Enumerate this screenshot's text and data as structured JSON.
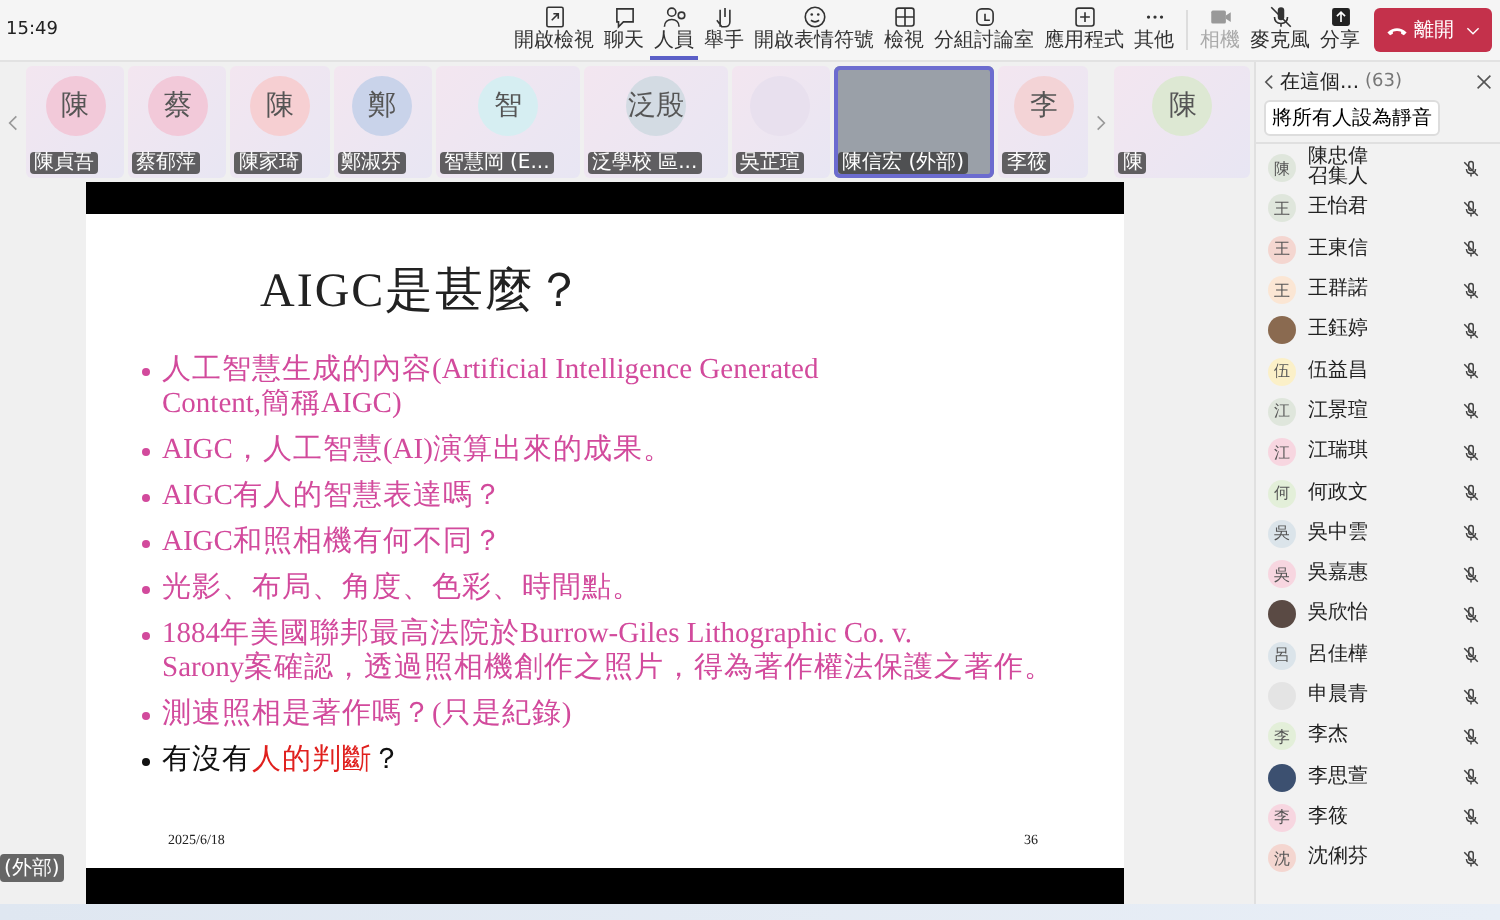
{
  "clock": "15:49",
  "toolbar": [
    {
      "label": "開啟檢視",
      "selected": false,
      "disabled": false
    },
    {
      "label": "聊天",
      "selected": false,
      "disabled": false
    },
    {
      "label": "人員",
      "selected": true,
      "disabled": false
    },
    {
      "label": "舉手",
      "selected": false,
      "disabled": false
    },
    {
      "label": "開啟表情符號",
      "selected": false,
      "disabled": false
    },
    {
      "label": "檢視",
      "selected": false,
      "disabled": false
    },
    {
      "label": "分組討論室",
      "selected": false,
      "disabled": false
    },
    {
      "label": "應用程式",
      "selected": false,
      "disabled": false
    },
    {
      "label": "其他",
      "selected": false,
      "disabled": false
    },
    {
      "label": "相機",
      "selected": false,
      "disabled": true
    },
    {
      "label": "麥克風",
      "selected": false,
      "disabled": false
    },
    {
      "label": "分享",
      "selected": false,
      "disabled": false
    }
  ],
  "leave_button": "離開",
  "strip": [
    {
      "kind": "initial",
      "initial": "陳",
      "name": "陳貞吾",
      "color": "#f2c9d9",
      "selected": false
    },
    {
      "kind": "initial",
      "initial": "蔡",
      "name": "蔡郁萍",
      "color": "#f2c9d9",
      "selected": false
    },
    {
      "kind": "initial",
      "initial": "陳",
      "name": "陳家琦",
      "color": "#f6cfd2",
      "selected": false
    },
    {
      "kind": "initial",
      "initial": "鄭",
      "name": "鄭淑芬",
      "color": "#c9d3ea",
      "selected": false
    },
    {
      "kind": "initial",
      "initial": "智",
      "name": "智慧岡 (E...",
      "color": "#d6eef2",
      "selected": false
    },
    {
      "kind": "initial",
      "initial": "泛殷",
      "name": "泛學校 區...",
      "color": "#d3dbe3",
      "selected": false
    },
    {
      "kind": "photo",
      "name": "吳芷瑄",
      "color": "#e8e0ee",
      "selected": false
    },
    {
      "kind": "video",
      "name": "陳信宏 (外部)",
      "color": "#9aa0a8",
      "selected": true
    },
    {
      "kind": "initial",
      "initial": "李",
      "name": "李筱",
      "color": "#f3d3d6",
      "selected": false
    },
    {
      "kind": "initial",
      "initial": "陳",
      "name": "陳",
      "color": "#dde8d3",
      "selected": false
    }
  ],
  "slide": {
    "title": "AIGC是甚麼？",
    "bullets": [
      {
        "color": "#d24a9c",
        "lines": [
          "人工智慧生成的內容(Artificial Intelligence Generated",
          "Content,簡稱AIGC)"
        ]
      },
      {
        "color": "#d24a9c",
        "lines": [
          "AIGC，人工智慧(AI)演算出來的成果。"
        ]
      },
      {
        "color": "#d24a9c",
        "lines": [
          "AIGC有人的智慧表達嗎？"
        ]
      },
      {
        "color": "#d24a9c",
        "lines": [
          "AIGC和照相機有何不同？"
        ]
      },
      {
        "color": "#d24a9c",
        "lines": [
          "光影、布局、角度、色彩、時間點。"
        ]
      },
      {
        "color": "#d24a9c",
        "lines": [
          "1884年美國聯邦最高法院於Burrow-Giles Lithographic Co. v.",
          "Sarony案確認，透過照相機創作之照片，得為著作權法保護之著作。"
        ]
      },
      {
        "color": "#d24a9c",
        "lines": [
          "測速照相是著作嗎？(只是紀錄)"
        ]
      },
      {
        "color": "#111111",
        "segments": [
          {
            "text": "有沒有",
            "emphasis": false
          },
          {
            "text": "人的判斷",
            "emphasis": true
          },
          {
            "text": "？",
            "emphasis": false
          }
        ]
      }
    ],
    "date": "2025/6/18",
    "page": "36"
  },
  "presenter_tag": "(外部)",
  "panel": {
    "title": "在這個...",
    "count": "(63)",
    "mute_all_button": "將所有人設為靜音",
    "people": [
      {
        "kind": "initial",
        "initial": "陳",
        "name": "陳忠偉",
        "role": "召集人",
        "color": "#dfe6dc"
      },
      {
        "kind": "initial",
        "initial": "王",
        "name": "王怡君",
        "color": "#dfe6dc"
      },
      {
        "kind": "initial",
        "initial": "王",
        "name": "王東信",
        "color": "#f4d6d0"
      },
      {
        "kind": "initial",
        "initial": "王",
        "name": "王群諾",
        "color": "#fbe6d4"
      },
      {
        "kind": "photo",
        "name": "王鈺婷",
        "color": "#8a6a50"
      },
      {
        "kind": "initial",
        "initial": "伍",
        "name": "伍益昌",
        "color": "#fbf0c8"
      },
      {
        "kind": "initial",
        "initial": "江",
        "name": "江景瑄",
        "color": "#dfe6dc"
      },
      {
        "kind": "initial",
        "initial": "江",
        "name": "江瑞琪",
        "color": "#f7d6e0"
      },
      {
        "kind": "initial",
        "initial": "何",
        "name": "何政文",
        "color": "#e3efd9"
      },
      {
        "kind": "initial",
        "initial": "吳",
        "name": "吳中雲",
        "color": "#dbe4ea"
      },
      {
        "kind": "initial",
        "initial": "吳",
        "name": "吳嘉惠",
        "color": "#f7d6e0"
      },
      {
        "kind": "photo",
        "name": "吳欣怡",
        "color": "#5a4a44"
      },
      {
        "kind": "initial",
        "initial": "呂",
        "name": "呂佳樺",
        "color": "#dbe4ea"
      },
      {
        "kind": "photo",
        "name": "申晨青",
        "color": "#e4e4e4"
      },
      {
        "kind": "initial",
        "initial": "李",
        "name": "李杰",
        "color": "#e3efd9"
      },
      {
        "kind": "photo",
        "name": "李思萱",
        "color": "#3c5070"
      },
      {
        "kind": "initial",
        "initial": "李",
        "name": "李筱",
        "color": "#f7d6e0"
      },
      {
        "kind": "initial",
        "initial": "沈",
        "name": "沈俐芬",
        "color": "#f4d6d0"
      }
    ]
  }
}
